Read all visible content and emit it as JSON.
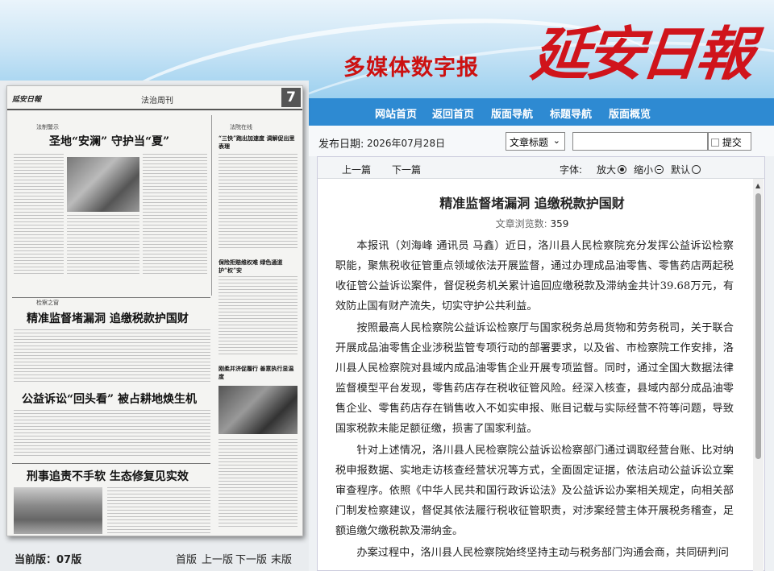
{
  "banner": {
    "subtitle": "多媒体数字报",
    "logo_text": "延安日報"
  },
  "nav": {
    "items": [
      "网站首页",
      "返回首页",
      "版面导航",
      "标题导航",
      "版面概览"
    ]
  },
  "newspaper": {
    "masthead": "延安日報",
    "page_label": "法治周刊",
    "page_number": "7",
    "headlines": [
      "圣地“安澜” 守护当“夏”",
      "精准监督堵漏洞 追缴税款护国财",
      "公益诉讼“回头看” 被占耕地焕生机",
      "刑事追责不手软 生态修复见实效",
      "“三快”跑出加速度 调解促出里表理",
      "保险拒赔维权难 绿色通道护“权”安",
      "刚柔并济促履行 善意执行显温度"
    ],
    "section_tags": [
      "法制警示",
      "法院在线",
      "检察之窗"
    ]
  },
  "edition": {
    "label": "当前版：07版",
    "pager": [
      "首版",
      "上一版",
      "下一版",
      "末版"
    ]
  },
  "datebar": {
    "label": "发布日期:",
    "date": "2026年07月28日",
    "select_value": "文章标题",
    "submit_label": "提交"
  },
  "toolbar": {
    "prev": "上一篇",
    "next": "下一篇",
    "font_label": "字体:",
    "larger": "放大",
    "smaller": "缩小",
    "default": "默认"
  },
  "article": {
    "title": "精准监督堵漏洞 追缴税款护国财",
    "views_label": "文章浏览数:",
    "views": "359",
    "paragraphs": [
      "本报讯（刘海峰 通讯员 马鑫）近日，洛川县人民检察院充分发挥公益诉讼检察职能，聚焦税收征管重点领域依法开展监督，通过办理成品油零售、零售药店两起税收征管公益诉讼案件，督促税务机关累计追回应缴税款及滞纳金共计39.68万元，有效防止国有财产流失，切实守护公共利益。",
      "按照最高人民检察院公益诉讼检察厅与国家税务总局货物和劳务税司，关于联合开展成品油零售企业涉税监管专项行动的部署要求，以及省、市检察院工作安排，洛川县人民检察院对县域内成品油零售企业开展专项监督。同时，通过全国大数据法律监督模型平台发现，零售药店存在税收征管风险。经深入核查，县域内部分成品油零售企业、零售药店存在销售收入不如实申报、账目记载与实际经营不符等问题，导致国家税款未能足额征缴，损害了国家利益。",
      "针对上述情况，洛川县人民检察院公益诉讼检察部门通过调取经营台账、比对纳税申报数据、实地走访核查经营状况等方式，全面固定证据，依法启动公益诉讼立案审查程序。依照《中华人民共和国行政诉讼法》及公益诉讼办案相关规定，向相关部门制发检察建议，督促其依法履行税收征管职责，对涉案经营主体开展税务稽查，足额追缴欠缴税款及滞纳金。",
      "办案过程中，洛川县人民检察院始终坚持主动与税务部门沟通会商，共同研判问"
    ]
  }
}
